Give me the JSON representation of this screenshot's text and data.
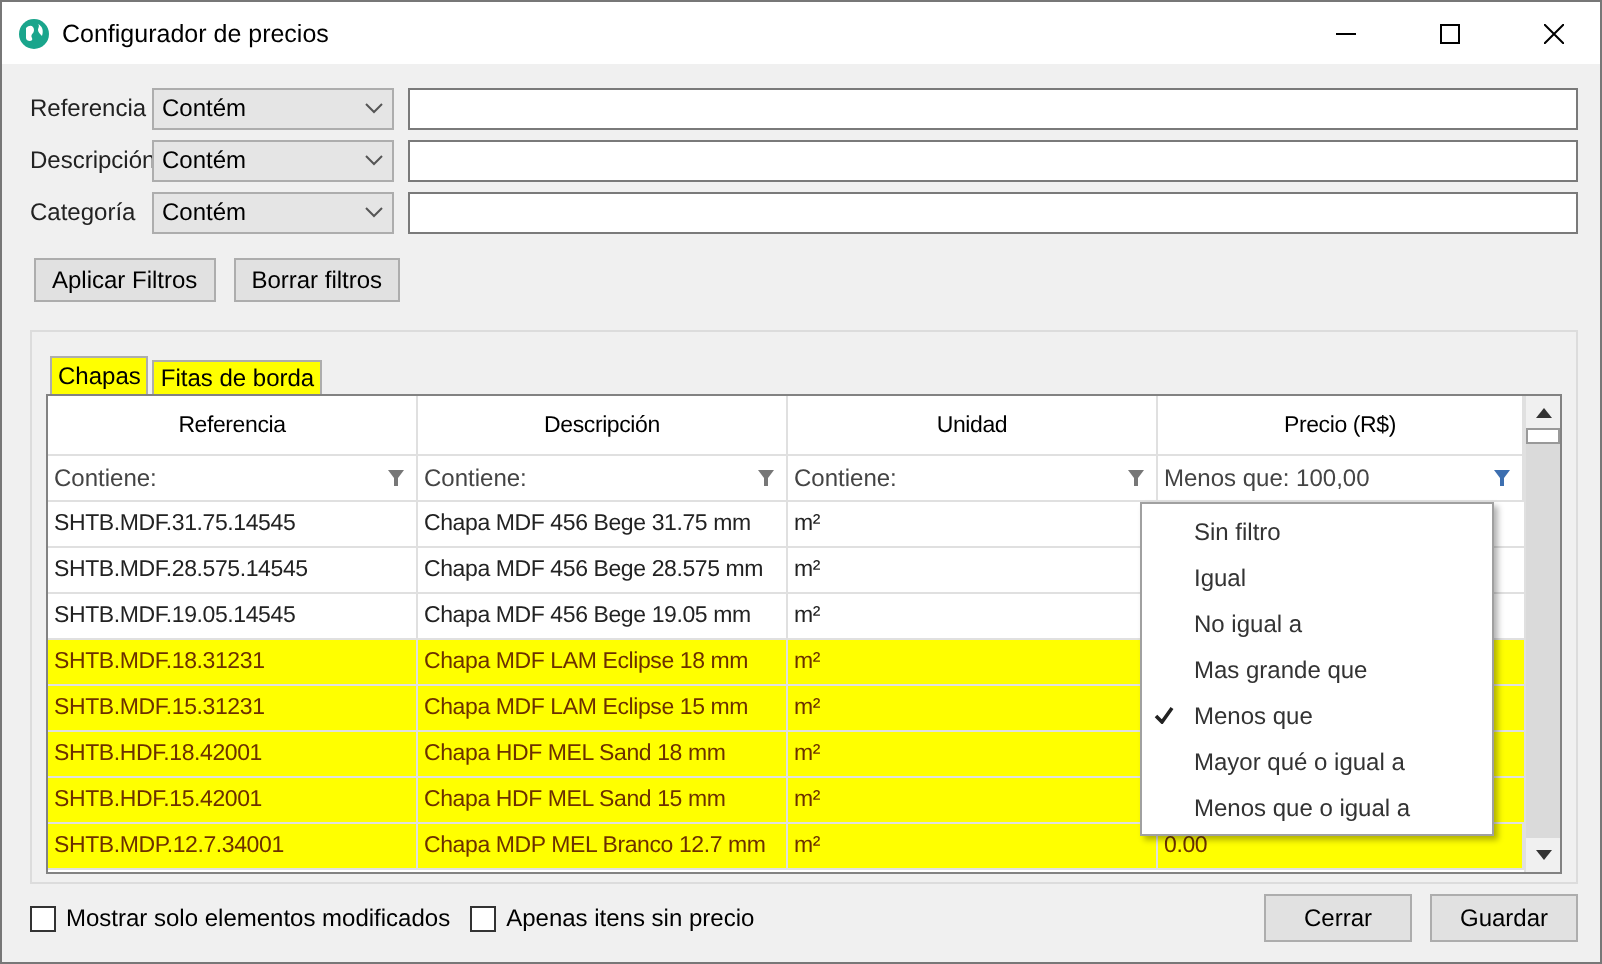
{
  "window": {
    "title": "Configurador de precios"
  },
  "filters": [
    {
      "label": "Referencia",
      "operator": "Contém"
    },
    {
      "label": "Descripción",
      "operator": "Contém"
    },
    {
      "label": "Categoría",
      "operator": "Contém"
    }
  ],
  "filter_buttons": [
    "Aplicar Filtros",
    "Borrar filtros"
  ],
  "tabs": [
    {
      "label": "Chapas",
      "selected": true
    },
    {
      "label": "Fitas de borda",
      "selected": false
    }
  ],
  "table": {
    "columns": [
      "Referencia",
      "Descripción",
      "Unidad",
      "Precio (R$)"
    ],
    "column_filters": [
      {
        "text": "Contiene:",
        "active": false
      },
      {
        "text": "Contiene:",
        "active": false
      },
      {
        "text": "Contiene:",
        "active": false
      },
      {
        "text": "Menos que:  100,00",
        "active": true
      }
    ],
    "rows": [
      {
        "reference": "SHTB.MDF.31.75.14545",
        "description": "Chapa MDF 456 Bege 31.75 mm",
        "unit": "m²",
        "highlighted": false
      },
      {
        "reference": "SHTB.MDF.28.575.14545",
        "description": "Chapa MDF 456 Bege 28.575 mm",
        "unit": "m²",
        "highlighted": false
      },
      {
        "reference": "SHTB.MDF.19.05.14545",
        "description": "Chapa MDF 456 Bege 19.05 mm",
        "unit": "m²",
        "highlighted": false
      },
      {
        "reference": "SHTB.MDF.18.31231",
        "description": "Chapa MDF LAM Eclipse 18 mm",
        "unit": "m²",
        "highlighted": true
      },
      {
        "reference": "SHTB.MDF.15.31231",
        "description": "Chapa MDF LAM Eclipse 15 mm",
        "unit": "m²",
        "highlighted": true
      },
      {
        "reference": "SHTB.HDF.18.42001",
        "description": "Chapa HDF MEL Sand 18 mm",
        "unit": "m²",
        "highlighted": true
      },
      {
        "reference": "SHTB.HDF.15.42001",
        "description": "Chapa HDF MEL Sand 15 mm",
        "unit": "m²",
        "highlighted": true
      },
      {
        "reference": "SHTB.MDP.12.7.34001",
        "description": "Chapa MDP MEL Branco 12.7 mm",
        "unit": "m²",
        "price": "0.00",
        "highlighted": true
      }
    ]
  },
  "filter_menu": [
    {
      "label": "Sin filtro",
      "checked": false
    },
    {
      "label": "Igual",
      "checked": false
    },
    {
      "label": "No igual a",
      "checked": false
    },
    {
      "label": "Mas grande que",
      "checked": false
    },
    {
      "label": "Menos que",
      "checked": true
    },
    {
      "label": "Mayor qué o igual a",
      "checked": false
    },
    {
      "label": "Menos que o igual a",
      "checked": false
    }
  ],
  "options": [
    {
      "label": "Mostrar solo elementos modificados",
      "checked": false
    },
    {
      "label": "Apenas itens sin precio",
      "checked": false
    }
  ],
  "buttons": [
    "Cerrar",
    "Guardar"
  ]
}
